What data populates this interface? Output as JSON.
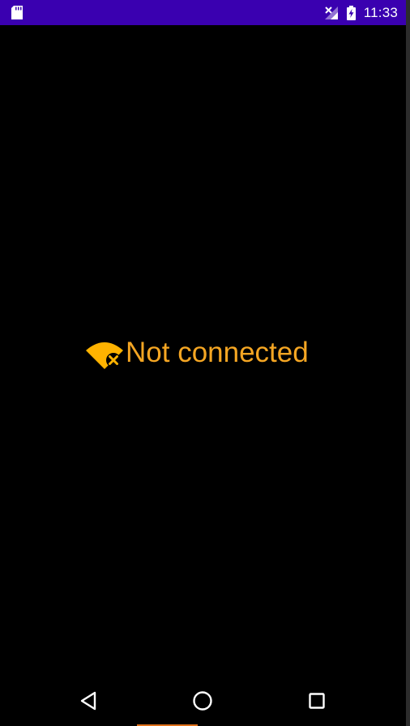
{
  "status_bar": {
    "time": "11:33",
    "background_color": "#3a00b0",
    "icons": [
      "sd-card-icon",
      "signal-off-icon",
      "battery-charging-icon"
    ]
  },
  "main": {
    "message": "Not connected",
    "message_color": "#f5a623",
    "icon": "wifi-off-icon"
  },
  "nav_bar": {
    "buttons": [
      "back",
      "home",
      "recents"
    ]
  }
}
